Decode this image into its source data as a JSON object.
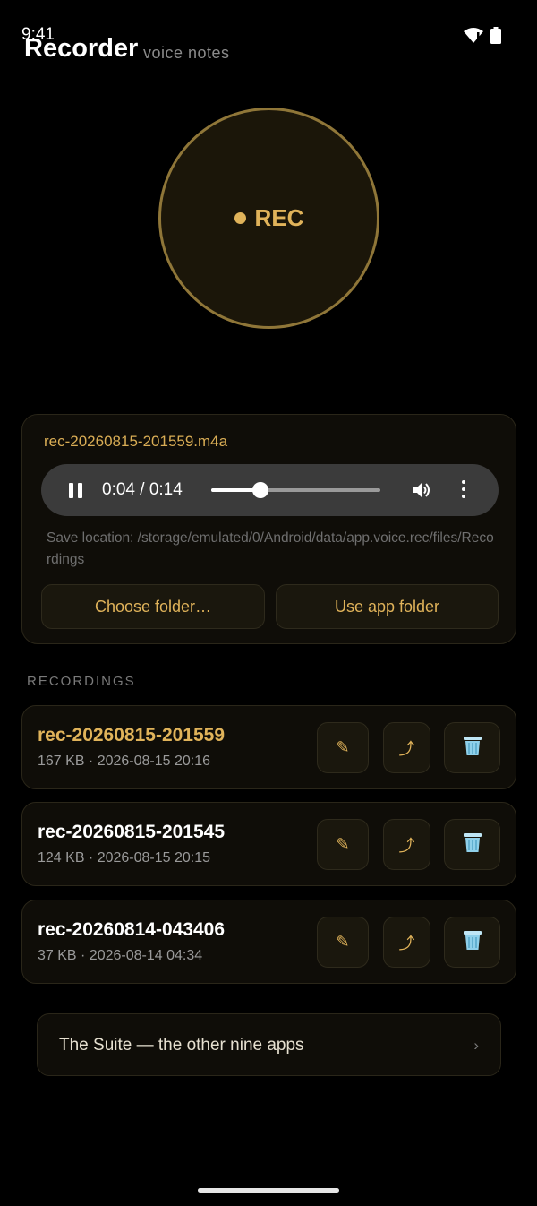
{
  "status_bar": {
    "time": "9:41"
  },
  "header": {
    "title": "Recorder",
    "subtitle": "voice notes"
  },
  "record_button": {
    "label": "REC"
  },
  "player": {
    "filename": "rec-20260815-201559.m4a",
    "time_display": "0:04 / 0:14",
    "progress_fraction": 0.29,
    "save_location": "Save location: /storage/emulated/0/Android/data/app.voice.rec/files/Recordings",
    "choose_folder_label": "Choose folder…",
    "use_app_folder_label": "Use app folder"
  },
  "recordings": {
    "section_label": "RECORDINGS",
    "items": [
      {
        "name": "rec-20260815-201559",
        "meta": "167 KB · 2026-08-15 20:16",
        "active": true
      },
      {
        "name": "rec-20260815-201545",
        "meta": "124 KB · 2026-08-15 20:15",
        "active": false
      },
      {
        "name": "rec-20260814-043406",
        "meta": "37 KB · 2026-08-14 04:34",
        "active": false
      }
    ],
    "icons": {
      "rename": "pencil-icon",
      "share": "share-icon",
      "delete": "trash-icon"
    }
  },
  "suite": {
    "label": "The Suite — the other nine apps",
    "chevron": "›"
  },
  "colors": {
    "accent": "#e0b35a",
    "background": "#000000",
    "card": "#0f0d08"
  }
}
